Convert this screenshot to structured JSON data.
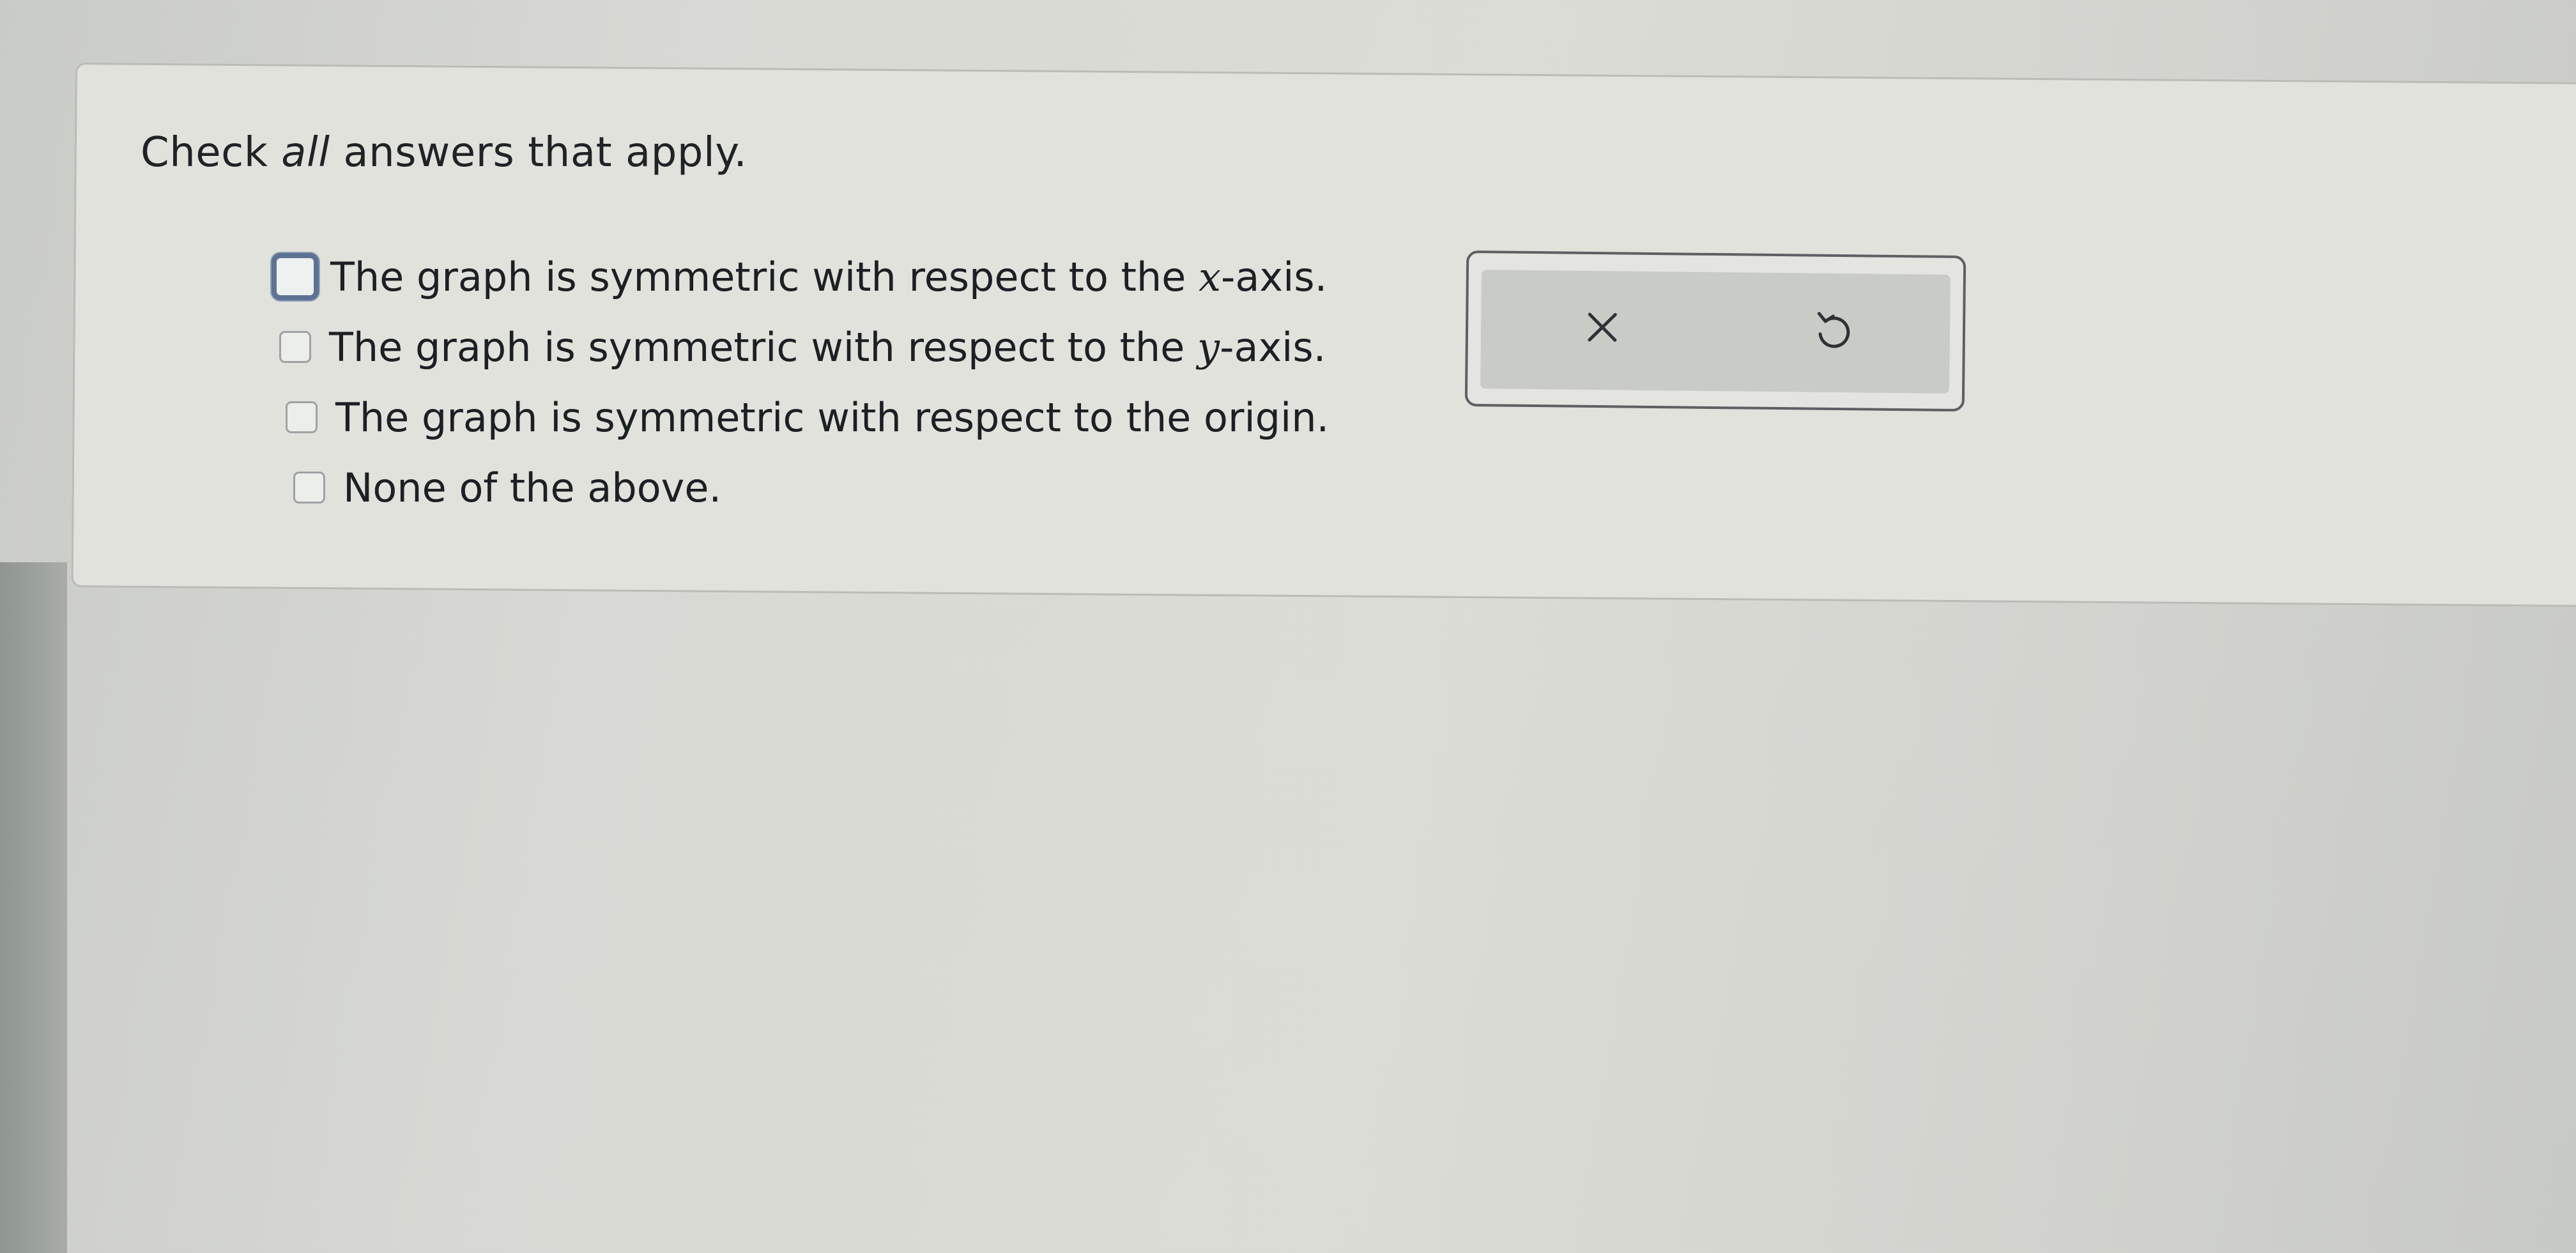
{
  "question": {
    "instruction_prefix": "Check ",
    "instruction_emphasis": "all",
    "instruction_suffix": " answers that apply."
  },
  "options": [
    {
      "prefix": "The graph is symmetric with respect to the ",
      "variable": "x",
      "suffix": "-axis.",
      "checked": false,
      "focused": true
    },
    {
      "prefix": "The graph is symmetric with respect to the ",
      "variable": "y",
      "suffix": "-axis.",
      "checked": false,
      "focused": false
    },
    {
      "prefix": "The graph is symmetric with respect to the origin.",
      "variable": "",
      "suffix": "",
      "checked": false,
      "focused": false
    },
    {
      "prefix": "None of the above.",
      "variable": "",
      "suffix": "",
      "checked": false,
      "focused": false
    }
  ],
  "toolbar": {
    "clear_icon": "x-icon",
    "undo_icon": "undo-icon"
  },
  "colors": {
    "focus_ring": "#5e7393",
    "text": "#1c2024",
    "toolbar_fill": "#c9cbc6"
  }
}
